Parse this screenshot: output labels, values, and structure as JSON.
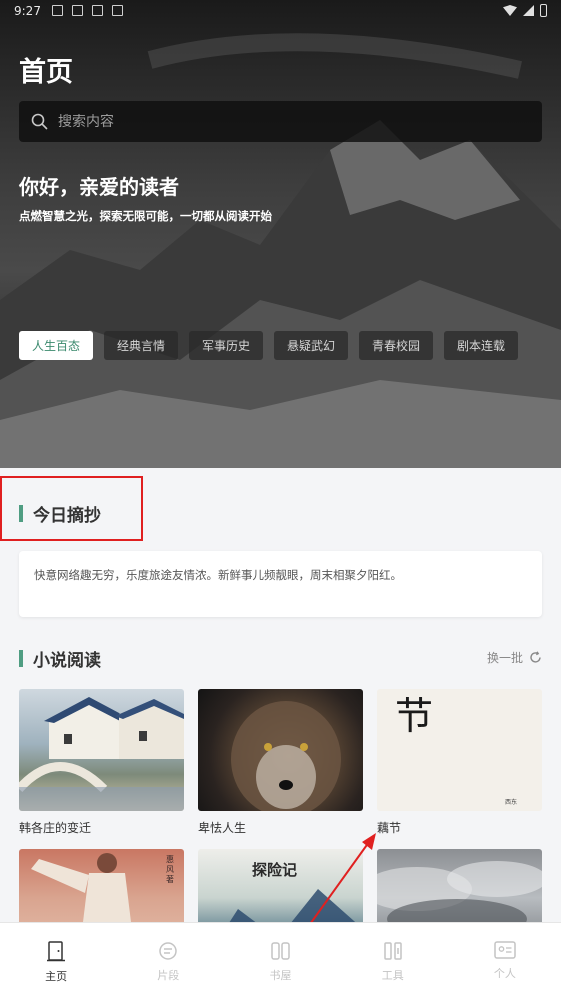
{
  "status_bar": {
    "time": "9:27"
  },
  "header": {
    "title": "首页",
    "search_placeholder": "搜索内容",
    "greeting": "你好，亲爱的读者",
    "slogan": "点燃智慧之光，探索无限可能，一切都从阅读开始"
  },
  "tags": [
    {
      "label": "人生百态",
      "active": true
    },
    {
      "label": "经典言情",
      "active": false
    },
    {
      "label": "军事历史",
      "active": false
    },
    {
      "label": "悬疑武幻",
      "active": false
    },
    {
      "label": "青春校园",
      "active": false
    },
    {
      "label": "剧本连载",
      "active": false
    }
  ],
  "daily_excerpt": {
    "title": "今日摘抄",
    "text": "快意网络趣无穷，乐度旅途友情浓。新鲜事儿频靓眼，周末相聚夕阳红。"
  },
  "novels": {
    "title": "小说阅读",
    "refresh_label": "换一批",
    "books": [
      {
        "title": "韩各庄的变迁"
      },
      {
        "title": "卑怯人生"
      },
      {
        "title": "藕节",
        "cover_text": "节",
        "cover_author": "西东"
      },
      {
        "title": "",
        "cover_text": "惠风著"
      },
      {
        "title": "",
        "cover_text": "探险记"
      },
      {
        "title": ""
      }
    ]
  },
  "bottom_nav": [
    {
      "label": "主页",
      "icon": "door-icon",
      "active": true
    },
    {
      "label": "片段",
      "icon": "chat-icon",
      "active": false
    },
    {
      "label": "书屋",
      "icon": "books-icon",
      "active": false
    },
    {
      "label": "工具",
      "icon": "tools-icon",
      "active": false
    },
    {
      "label": "个人",
      "icon": "profile-card-icon",
      "active": false
    }
  ],
  "colors": {
    "accent": "#4f9d82",
    "highlight_box": "#e02020",
    "arrow": "#e02020"
  }
}
